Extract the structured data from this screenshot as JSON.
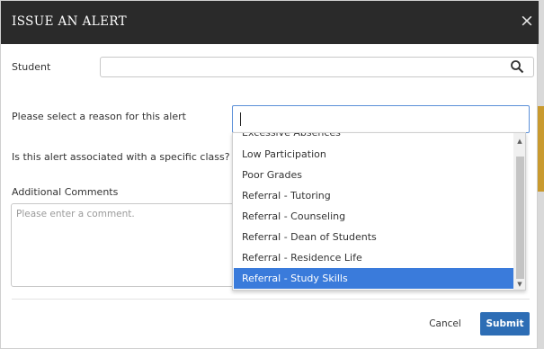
{
  "modal": {
    "title": "ISSUE AN ALERT",
    "close_glyph": "×"
  },
  "student": {
    "label": "Student",
    "value": "",
    "search_icon": "search-icon"
  },
  "reason": {
    "label": "Please select a reason for this alert",
    "value": "",
    "options": [
      "Excessive Absences",
      "Low Participation",
      "Poor Grades",
      "Referral - Tutoring",
      "Referral - Counseling",
      "Referral - Dean of Students",
      "Referral - Residence Life",
      "Referral - Study Skills"
    ],
    "highlighted_option": "Referral - Study Skills"
  },
  "class_question": {
    "label": "Is this alert associated with a specific class?"
  },
  "comments": {
    "label": "Additional Comments",
    "placeholder": "Please enter a comment."
  },
  "footer": {
    "cancel_label": "Cancel",
    "submit_label": "Submit"
  },
  "colors": {
    "header_bg": "#2a2a2a",
    "selected_option_bg": "#3a7bdb",
    "submit_bg": "#2d6db5"
  }
}
